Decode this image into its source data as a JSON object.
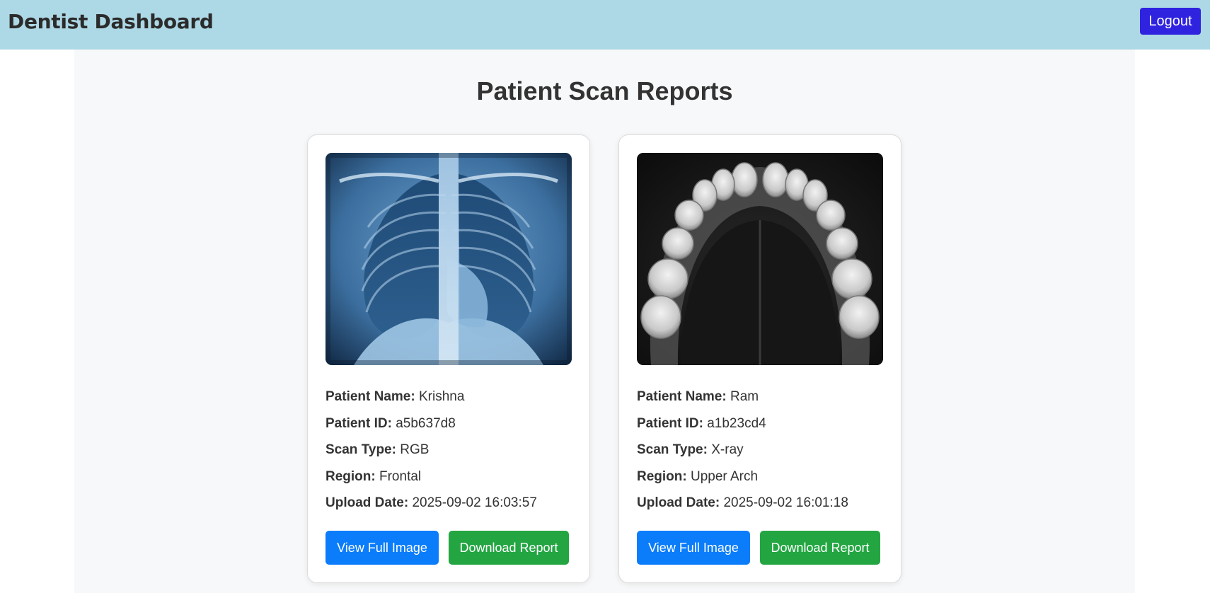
{
  "header": {
    "title": "Dentist Dashboard",
    "logout_label": "Logout",
    "bg_color": "#add8e6",
    "logout_color": "#2f23e0"
  },
  "main": {
    "title": "Patient Scan Reports"
  },
  "reports": [
    {
      "image_icon": "chest-xray-image",
      "name_label": "Patient Name:",
      "name": "Krishna",
      "id_label": "Patient ID:",
      "id": "a5b637d8",
      "scan_type_label": "Scan Type:",
      "scan_type": "RGB",
      "region_label": "Region:",
      "region": "Frontal",
      "upload_date_label": "Upload Date:",
      "upload_date": "2025-09-02 16:03:57",
      "view_label": "View Full Image",
      "download_label": "Download Report"
    },
    {
      "image_icon": "dental-arch-xray-image",
      "name_label": "Patient Name:",
      "name": "Ram",
      "id_label": "Patient ID:",
      "id": "a1b23cd4",
      "scan_type_label": "Scan Type:",
      "scan_type": "X-ray",
      "region_label": "Region:",
      "region": "Upper Arch",
      "upload_date_label": "Upload Date:",
      "upload_date": "2025-09-02 16:01:18",
      "view_label": "View Full Image",
      "download_label": "Download Report"
    }
  ],
  "colors": {
    "view_button": "#0b7dfa",
    "download_button": "#23a642"
  }
}
